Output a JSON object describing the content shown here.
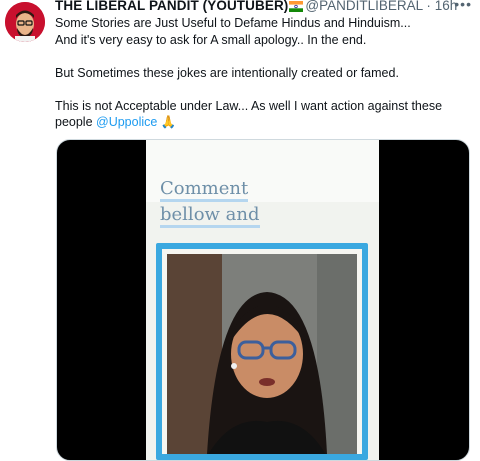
{
  "author": {
    "name": "THE LIBERAL PANDIT (YOUTUBER)",
    "flag_icon": "india-flag-icon",
    "handle": "@PANDITLIBERAL",
    "separator": "·",
    "time": "16h",
    "more_icon": "more-horizontal-icon"
  },
  "tweet": {
    "line1": "Some Stories are Just Useful to Defame Hindus and Hinduism...",
    "line2": "And it's very easy to ask for A small apology.. In the end.",
    "line3": "But Sometimes these jokes are intentionally created or famed.",
    "line4": "This is not Acceptable under Law... As well I want action against these",
    "line5_prefix": "people ",
    "mention": "@Uppolice",
    "emoji": "🙏"
  },
  "media": {
    "overlay_line1": "Comment",
    "overlay_line2": "bellow and"
  },
  "colors": {
    "link": "#1d9bf0",
    "frame": "#3aa8e0"
  }
}
